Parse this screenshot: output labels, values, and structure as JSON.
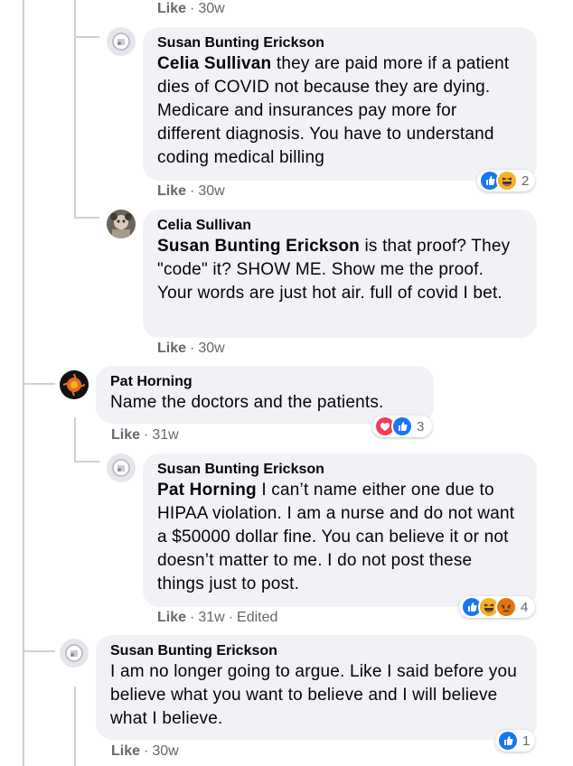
{
  "top_meta": {
    "like": "Like",
    "time": "30w"
  },
  "comments": [
    {
      "author": "Susan Bunting Erickson",
      "mention": "Celia Sullivan",
      "text": " they are paid more if a patient dies of COVID not because they are dying. Medicare and insurances pay more for different diagnosis. You have to understand coding medical billing",
      "like": "Like",
      "time": "30w",
      "reactions": {
        "icons": [
          "like-reaction",
          "haha-reaction"
        ],
        "count": "2"
      }
    },
    {
      "author": "Celia Sullivan",
      "mention": "Susan Bunting Erickson",
      "text": " is that proof? They \"code\" it? SHOW ME. Show me the proof. Your words are just hot air. full of covid I bet.",
      "like": "Like",
      "time": "30w"
    },
    {
      "author": "Pat Horning",
      "mention": "",
      "text": "Name the doctors and the patients.",
      "like": "Like",
      "time": "31w",
      "reactions": {
        "icons": [
          "love-reaction",
          "like-reaction"
        ],
        "count": "3"
      }
    },
    {
      "author": "Susan Bunting Erickson",
      "mention": "Pat Horning",
      "text": " I can’t name either one due to HIPAA violation. I am a nurse and do not want a $50000 dollar fine. You can believe it or not doesn’t matter to me. I do not post these things just to post.",
      "like": "Like",
      "time": "31w",
      "edited": "Edited",
      "reactions": {
        "icons": [
          "like-reaction",
          "haha-reaction",
          "angry-reaction"
        ],
        "count": "4"
      }
    },
    {
      "author": "Susan Bunting Erickson",
      "mention": "",
      "text": "I am no longer going to argue. Like I said before you believe what you want to believe and I will believe what I believe.",
      "like": "Like",
      "time": "30w",
      "reactions": {
        "icons": [
          "like-reaction"
        ],
        "count": "1"
      }
    }
  ],
  "colors": {
    "like": "#1877f2",
    "love": "#f33e58",
    "haha": "#f7b125",
    "angry": "#e9710f"
  }
}
